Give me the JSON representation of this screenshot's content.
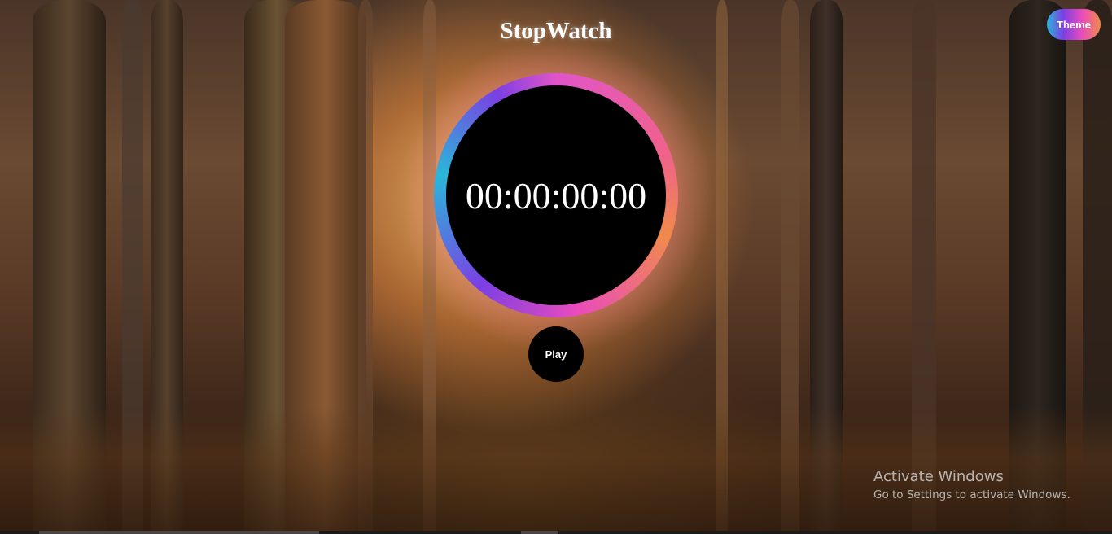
{
  "header": {
    "title": "StopWatch",
    "theme_label": "Theme"
  },
  "stopwatch": {
    "time": "00:00:00:00",
    "play_label": "Play"
  },
  "watermark": {
    "title": "Activate Windows",
    "subtitle": "Go to Settings to activate Windows."
  },
  "colors": {
    "ring_gradient": [
      "#2ab7d8",
      "#7b3fe4",
      "#e94bbd",
      "#f08a4b"
    ],
    "clock_face": "#000000",
    "text": "#ffffff"
  },
  "icons": {
    "background": "forest-background-image"
  }
}
